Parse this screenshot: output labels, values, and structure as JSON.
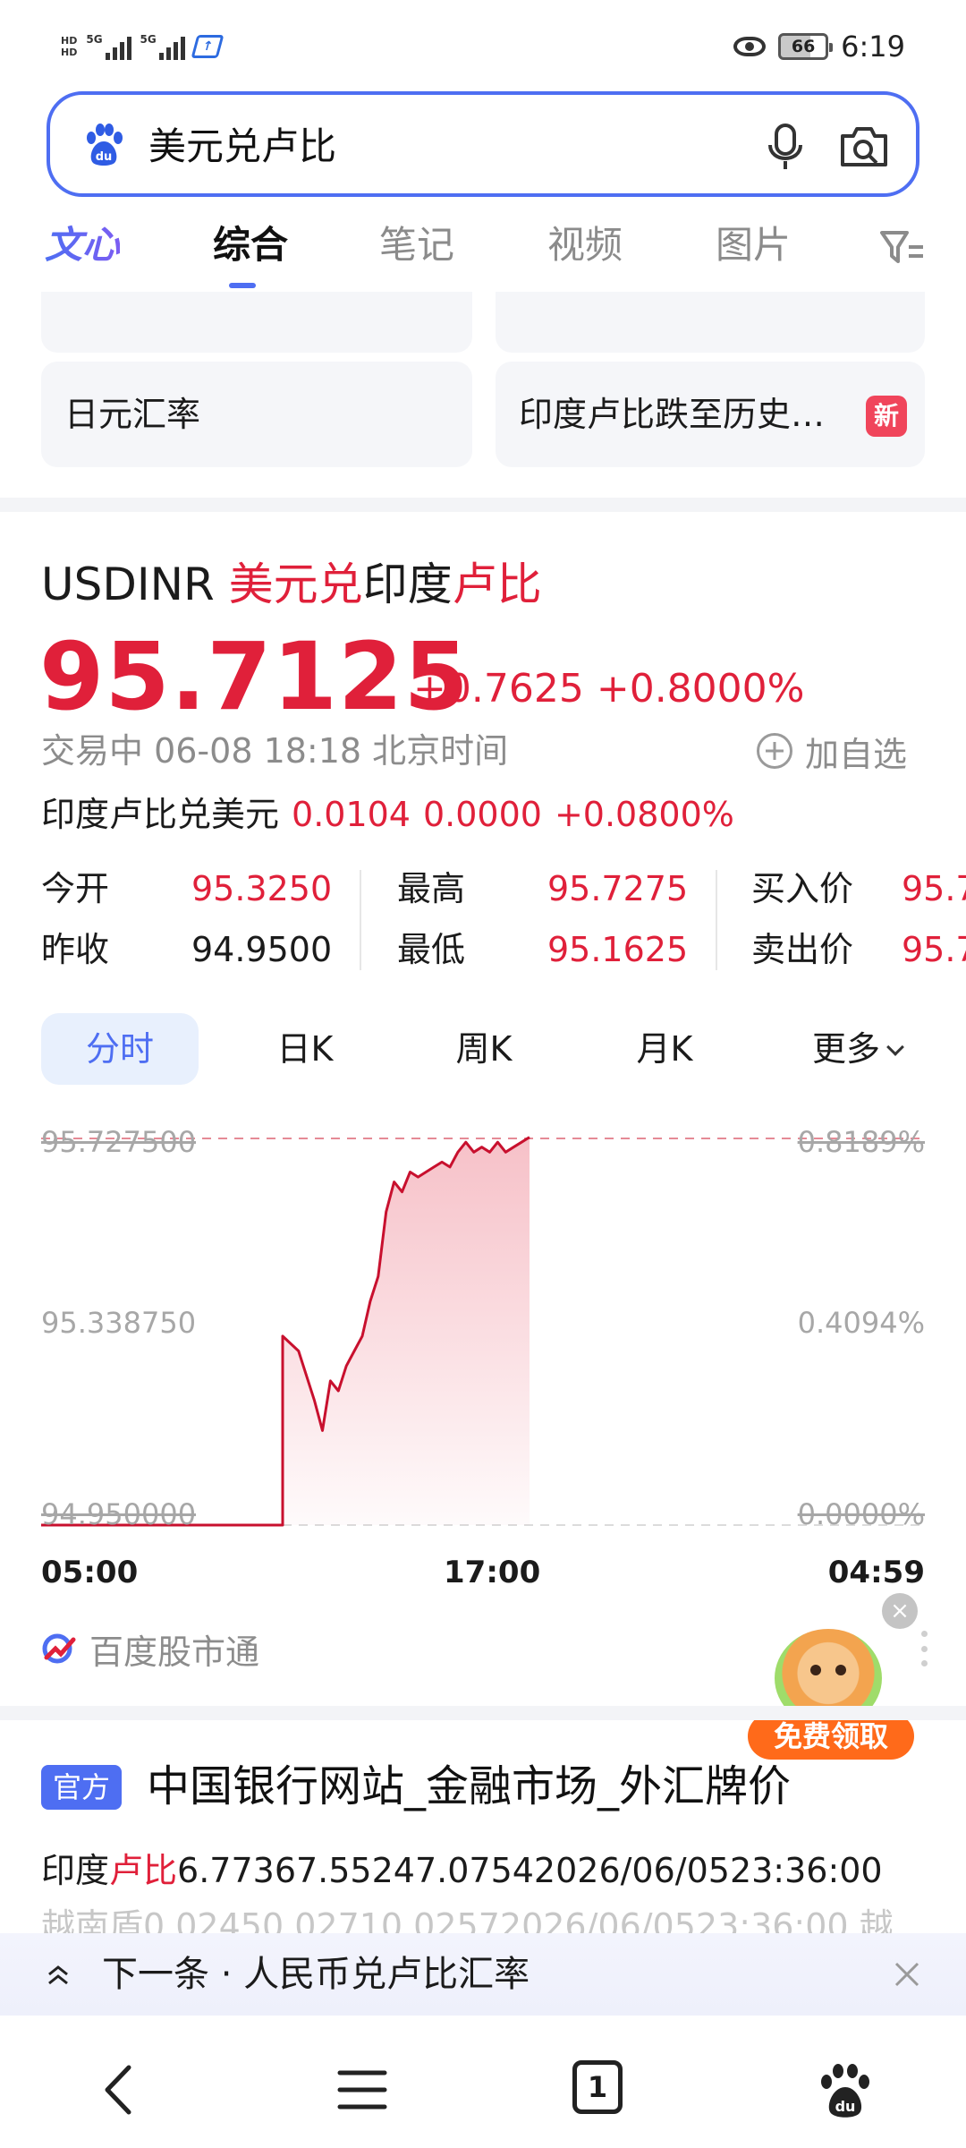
{
  "status_bar": {
    "hd_top": "HD",
    "hd_bottom": "HD",
    "net1": "5G",
    "net2": "5G",
    "battery": "66",
    "time": "6:19",
    "icons": [
      "eye-icon",
      "wifi-icon",
      "signal-icon",
      "battery-icon"
    ]
  },
  "search": {
    "query": "美元兑卢比",
    "icons": [
      "baidu-paw-icon",
      "microphone-icon",
      "camera-search-icon"
    ]
  },
  "tabs": [
    {
      "label": "文心"
    },
    {
      "label": "综合"
    },
    {
      "label": "笔记"
    },
    {
      "label": "视频"
    },
    {
      "label": "图片"
    }
  ],
  "related": {
    "cards": [
      {
        "label": "日元汇率"
      },
      {
        "label": "印度卢比跌至历史…"
      }
    ],
    "new_badge": "新"
  },
  "quote": {
    "symbol": "USDINR",
    "title_parts": [
      "美元兑",
      "印度",
      "卢比"
    ],
    "price": "95.7125",
    "change": "+0.7625",
    "change_pct": "+0.8000%",
    "status": "交易中 06-08 18:18 北京时间",
    "add_watch": "加自选",
    "inverse_label": "印度卢比兑美元",
    "inverse_price": "0.0104",
    "inverse_change": "0.0000",
    "inverse_pct": "+0.0800%",
    "stats": {
      "open_label": "今开",
      "open": "95.3250",
      "prev_label": "昨收",
      "prev": "94.9500",
      "high_label": "最高",
      "high": "95.7275",
      "low_label": "最低",
      "low": "95.1625",
      "bid_label": "买入价",
      "bid": "95.7",
      "ask_label": "卖出价",
      "ask": "95.7"
    },
    "colors": {
      "up": "#e0203a",
      "accent": "#4e6ef2"
    }
  },
  "period_tabs": [
    {
      "label": "分时"
    },
    {
      "label": "日K"
    },
    {
      "label": "周K"
    },
    {
      "label": "月K"
    },
    {
      "label": "更多"
    }
  ],
  "chart_data": {
    "type": "area",
    "y_labels_left": [
      "95.727500",
      "95.338750",
      "94.950000"
    ],
    "y_labels_right": [
      "0.8189%",
      "0.4094%",
      "0.0000%"
    ],
    "x_labels": [
      "05:00",
      "17:00",
      "04:59"
    ],
    "ylim": [
      94.95,
      95.7275
    ],
    "reference_line": 95.7275,
    "series": [
      {
        "values": [
          94.95,
          94.95,
          94.95,
          94.95,
          94.95,
          94.95,
          94.95,
          94.95,
          95.33,
          95.3,
          95.25,
          95.2,
          95.14,
          95.24,
          95.22,
          95.27,
          95.3,
          95.33,
          95.4,
          95.45,
          95.58,
          95.64,
          95.62,
          95.66,
          95.65,
          95.66,
          95.67,
          95.68,
          95.67,
          95.7,
          95.72,
          95.7,
          95.71,
          95.7,
          95.72,
          95.7,
          95.71,
          95.72,
          95.73
        ]
      }
    ]
  },
  "source": {
    "label": "百度股市通"
  },
  "promo": {
    "button": "免费领取",
    "close": "×"
  },
  "result": {
    "badge": "官方",
    "title": "中国银行网站_金融市场_外汇牌价",
    "row_label_a": "印度",
    "row_label_b": "卢比",
    "row_values": "6.77367.55247.07542026/06/0523:36:00",
    "row2": "越南盾0.02450.02710.02572026/06/0523:36:00 越"
  },
  "next_bar": {
    "text": "下一条 · 人民币兑卢比汇率"
  },
  "bottom_nav": {
    "icons": [
      "back-icon",
      "menu-icon",
      "tabs-icon",
      "home-paw-icon"
    ],
    "tab_count": "1"
  }
}
